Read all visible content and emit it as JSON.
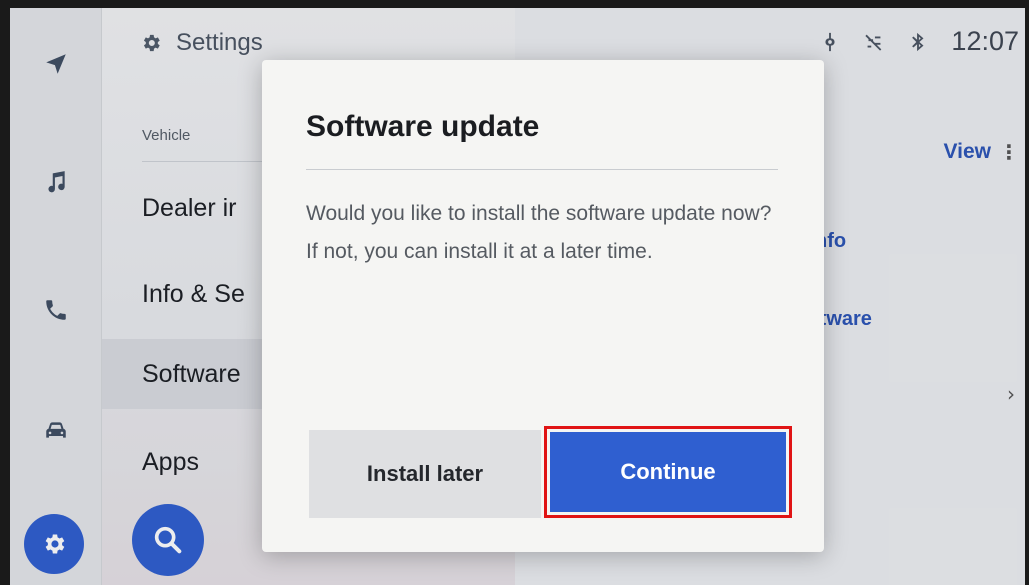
{
  "settings": {
    "title": "Settings",
    "section_label": "Vehicle",
    "items": [
      {
        "label": "Dealer ir"
      },
      {
        "label": "Info & Se"
      },
      {
        "label": "Software"
      },
      {
        "label": "Apps"
      }
    ]
  },
  "status_bar": {
    "time": "12:07",
    "icons": [
      "wireless-charging-icon",
      "voice-muted-icon",
      "bluetooth-icon"
    ]
  },
  "right_panel": {
    "view_label": "View",
    "kebab": "⋮",
    "items": [
      {
        "label": "nfo"
      },
      {
        "label": "ftware"
      }
    ],
    "chevron": "›"
  },
  "rail": {
    "icons": [
      "navigation-icon",
      "music-icon",
      "phone-icon",
      "car-icon",
      "settings-gear-icon"
    ],
    "active": "settings-gear-icon"
  },
  "dialog": {
    "title": "Software update",
    "body": "Would you like to install the software update now? If not, you can install it at a later time.",
    "install_later_label": "Install later",
    "continue_label": "Continue"
  },
  "colors": {
    "accent": "#2f5fd0",
    "link": "#2c55b8",
    "highlight_box": "#e01414"
  }
}
